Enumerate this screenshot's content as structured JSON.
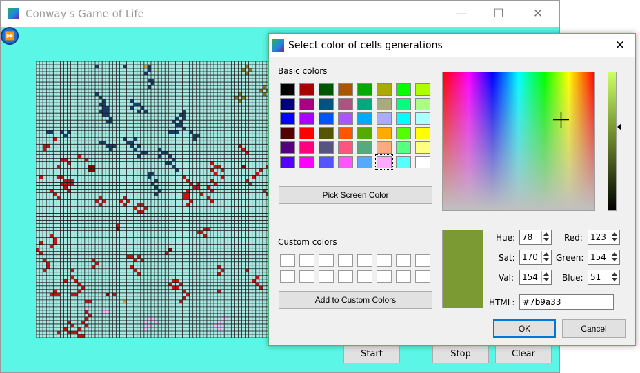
{
  "main_window": {
    "title": "Conway's Game of Life",
    "minimize_glyph": "—",
    "maximize_glyph": "☐",
    "close_glyph": "✕",
    "background_color": "#5bf6e6",
    "buttons": {
      "start": "Start",
      "stop": "Stop",
      "clear": "Clear"
    },
    "fast_forward_glyph": "⏩"
  },
  "grid": {
    "cols": 67,
    "rows": 80,
    "cell_color": "#a8e8e2",
    "line_color": "#1a1a1a",
    "cells": [
      [
        3,
        20,
        "#1b3e6b"
      ],
      [
        4,
        20,
        "#1b3e6b"
      ],
      [
        17,
        1,
        "#1b3e6b"
      ],
      [
        25,
        1,
        "#1b3e6b"
      ],
      [
        31,
        1,
        "#c9b016"
      ],
      [
        32,
        1,
        "#1b3e6b"
      ],
      [
        32,
        2,
        "#1b3e6b"
      ],
      [
        31,
        3,
        "#1b3e6b"
      ],
      [
        32,
        5,
        "#1b3e6b"
      ],
      [
        33,
        5,
        "#1b3e6b"
      ],
      [
        33,
        6,
        "#1b3e6b"
      ],
      [
        32,
        7,
        "#1b3e6b"
      ],
      [
        60,
        1,
        "#8a7a1a"
      ],
      [
        59,
        2,
        "#8a7a1a"
      ],
      [
        61,
        2,
        "#8a7a1a"
      ],
      [
        60,
        3,
        "#8a7a1a"
      ],
      [
        65,
        7,
        "#8a7a1a"
      ],
      [
        64,
        8,
        "#8a7a1a"
      ],
      [
        66,
        8,
        "#8a7a1a"
      ],
      [
        65,
        9,
        "#8a7a1a"
      ],
      [
        58,
        9,
        "#8a7a1a"
      ],
      [
        57,
        10,
        "#8a7a1a"
      ],
      [
        59,
        10,
        "#8a7a1a"
      ],
      [
        58,
        11,
        "#8a7a1a"
      ],
      [
        17,
        9,
        "#1b3e6b"
      ],
      [
        18,
        10,
        "#1b3e6b"
      ],
      [
        19,
        11,
        "#1b3e6b"
      ],
      [
        18,
        12,
        "#1b3e6b"
      ],
      [
        19,
        12,
        "#1b3e6b"
      ],
      [
        19,
        13,
        "#1b3e6b"
      ],
      [
        20,
        13,
        "#1b3e6b"
      ],
      [
        18,
        14,
        "#1b3e6b"
      ],
      [
        19,
        14,
        "#1b3e6b"
      ],
      [
        20,
        14,
        "#1b3e6b"
      ],
      [
        19,
        15,
        "#1b3e6b"
      ],
      [
        20,
        15,
        "#1b3e6b"
      ],
      [
        21,
        16,
        "#1b3e6b"
      ],
      [
        20,
        17,
        "#1b3e6b"
      ],
      [
        21,
        17,
        "#1b3e6b"
      ],
      [
        27,
        11,
        "#1b3e6b"
      ],
      [
        28,
        12,
        "#1b3e6b"
      ],
      [
        29,
        12,
        "#1b3e6b"
      ],
      [
        27,
        13,
        "#1b3e6b"
      ],
      [
        30,
        13,
        "#1b3e6b"
      ],
      [
        31,
        14,
        "#1b3e6b"
      ],
      [
        29,
        14,
        "#1b3e6b"
      ],
      [
        42,
        14,
        "#1b3e6b"
      ],
      [
        41,
        15,
        "#1b3e6b"
      ],
      [
        42,
        15,
        "#1b3e6b"
      ],
      [
        40,
        16,
        "#1b3e6b"
      ],
      [
        42,
        16,
        "#1b3e6b"
      ],
      [
        39,
        17,
        "#1b3e6b"
      ],
      [
        41,
        17,
        "#1b3e6b"
      ],
      [
        40,
        18,
        "#1b3e6b"
      ],
      [
        41,
        18,
        "#1b3e6b"
      ],
      [
        42,
        19,
        "#1b3e6b"
      ],
      [
        38,
        20,
        "#1b3e6b"
      ],
      [
        39,
        20,
        "#1b3e6b"
      ],
      [
        40,
        20,
        "#1b3e6b"
      ],
      [
        7,
        20,
        "#1b3e6b"
      ],
      [
        8,
        21,
        "#1b3e6b"
      ],
      [
        9,
        20,
        "#1b3e6b"
      ],
      [
        18,
        23,
        "#1b3e6b"
      ],
      [
        19,
        23,
        "#1b3e6b"
      ],
      [
        20,
        24,
        "#1b3e6b"
      ],
      [
        21,
        24,
        "#1b3e6b"
      ],
      [
        22,
        24,
        "#1b3e6b"
      ],
      [
        21,
        25,
        "#1b3e6b"
      ],
      [
        25,
        22,
        "#1b3e6b"
      ],
      [
        26,
        23,
        "#1b3e6b"
      ],
      [
        27,
        23,
        "#1b3e6b"
      ],
      [
        28,
        22,
        "#1b3e6b"
      ],
      [
        29,
        24,
        "#1b3e6b"
      ],
      [
        27,
        24,
        "#1b3e6b"
      ],
      [
        28,
        25,
        "#1b3e6b"
      ],
      [
        30,
        26,
        "#1b3e6b"
      ],
      [
        31,
        26,
        "#1b3e6b"
      ],
      [
        29,
        27,
        "#1b3e6b"
      ],
      [
        35,
        25,
        "#1b3e6b"
      ],
      [
        36,
        26,
        "#1b3e6b"
      ],
      [
        37,
        26,
        "#1b3e6b"
      ],
      [
        35,
        27,
        "#1b3e6b"
      ],
      [
        38,
        27,
        "#1b3e6b"
      ],
      [
        39,
        28,
        "#1b3e6b"
      ],
      [
        37,
        29,
        "#1b3e6b"
      ],
      [
        38,
        29,
        "#1b3e6b"
      ],
      [
        39,
        30,
        "#1b3e6b"
      ],
      [
        40,
        31,
        "#1b3e6b"
      ],
      [
        32,
        32,
        "#1b3e6b"
      ],
      [
        33,
        32,
        "#1b3e6b"
      ],
      [
        32,
        33,
        "#1b3e6b"
      ],
      [
        34,
        34,
        "#1b3e6b"
      ],
      [
        33,
        35,
        "#1b3e6b"
      ],
      [
        34,
        36,
        "#1b3e6b"
      ],
      [
        35,
        37,
        "#1b3e6b"
      ],
      [
        34,
        38,
        "#1b3e6b"
      ],
      [
        44,
        20,
        "#1b3e6b"
      ],
      [
        45,
        21,
        "#1b3e6b"
      ],
      [
        46,
        21,
        "#1b3e6b"
      ],
      [
        45,
        22,
        "#1b3e6b"
      ],
      [
        5,
        22,
        "#c41414"
      ],
      [
        2,
        24,
        "#c41414"
      ],
      [
        2,
        25,
        "#c41414"
      ],
      [
        3,
        24,
        "#c41414"
      ],
      [
        7,
        28,
        "#c41414"
      ],
      [
        8,
        28,
        "#c41414"
      ],
      [
        9,
        29,
        "#c41414"
      ],
      [
        6,
        30,
        "#c41414"
      ],
      [
        1,
        33,
        "#c41414"
      ],
      [
        6,
        33,
        "#c41414"
      ],
      [
        7,
        33,
        "#c41414"
      ],
      [
        8,
        34,
        "#c41414"
      ],
      [
        9,
        34,
        "#c41414"
      ],
      [
        10,
        34,
        "#c41414"
      ],
      [
        7,
        35,
        "#c41414"
      ],
      [
        8,
        35,
        "#c41414"
      ],
      [
        9,
        35,
        "#c41414"
      ],
      [
        10,
        35,
        "#c41414"
      ],
      [
        8,
        36,
        "#c41414"
      ],
      [
        9,
        37,
        "#c41414"
      ],
      [
        4,
        37,
        "#c41414"
      ],
      [
        5,
        38,
        "#c41414"
      ],
      [
        6,
        39,
        "#c41414"
      ],
      [
        15,
        30,
        "#8b0000"
      ],
      [
        16,
        30,
        "#8b0000"
      ],
      [
        15,
        31,
        "#8b0000"
      ],
      [
        16,
        31,
        "#8b0000"
      ],
      [
        12,
        27,
        "#c41414"
      ],
      [
        14,
        28,
        "#c41414"
      ],
      [
        18,
        39,
        "#c41414"
      ],
      [
        17,
        40,
        "#c41414"
      ],
      [
        19,
        40,
        "#c41414"
      ],
      [
        18,
        41,
        "#c41414"
      ],
      [
        25,
        39,
        "#c41414"
      ],
      [
        24,
        40,
        "#c41414"
      ],
      [
        26,
        40,
        "#c41414"
      ],
      [
        25,
        41,
        "#c41414"
      ],
      [
        29,
        41,
        "#c41414"
      ],
      [
        30,
        41,
        "#c41414"
      ],
      [
        28,
        42,
        "#c41414"
      ],
      [
        31,
        42,
        "#c41414"
      ],
      [
        29,
        43,
        "#c41414"
      ],
      [
        30,
        43,
        "#c41414"
      ],
      [
        42,
        33,
        "#c41414"
      ],
      [
        43,
        34,
        "#c41414"
      ],
      [
        44,
        35,
        "#c41414"
      ],
      [
        46,
        35,
        "#c41414"
      ],
      [
        45,
        36,
        "#c41414"
      ],
      [
        46,
        36,
        "#c41414"
      ],
      [
        43,
        37,
        "#c41414"
      ],
      [
        42,
        38,
        "#c41414"
      ],
      [
        43,
        38,
        "#c41414"
      ],
      [
        42,
        39,
        "#c41414"
      ],
      [
        43,
        39,
        "#c41414"
      ],
      [
        44,
        40,
        "#c41414"
      ],
      [
        43,
        41,
        "#c41414"
      ],
      [
        50,
        29,
        "#c41414"
      ],
      [
        51,
        30,
        "#c41414"
      ],
      [
        52,
        30,
        "#c41414"
      ],
      [
        50,
        31,
        "#c41414"
      ],
      [
        53,
        31,
        "#c41414"
      ],
      [
        51,
        32,
        "#c41414"
      ],
      [
        53,
        33,
        "#c41414"
      ],
      [
        50,
        34,
        "#c41414"
      ],
      [
        51,
        35,
        "#c41414"
      ],
      [
        49,
        36,
        "#c41414"
      ],
      [
        50,
        37,
        "#c41414"
      ],
      [
        47,
        38,
        "#c41414"
      ],
      [
        49,
        39,
        "#c41414"
      ],
      [
        50,
        40,
        "#c41414"
      ],
      [
        58,
        24,
        "#c41414"
      ],
      [
        59,
        25,
        "#c41414"
      ],
      [
        60,
        26,
        "#c41414"
      ],
      [
        59,
        30,
        "#8b0000"
      ],
      [
        64,
        31,
        "#c41414"
      ],
      [
        63,
        32,
        "#c41414"
      ],
      [
        62,
        33,
        "#c41414"
      ],
      [
        60,
        34,
        "#c41414"
      ],
      [
        61,
        35,
        "#c41414"
      ],
      [
        66,
        30,
        "#c41414"
      ],
      [
        65,
        37,
        "#c41414"
      ],
      [
        66,
        38,
        "#c41414"
      ],
      [
        23,
        47,
        "#c41414"
      ],
      [
        48,
        48,
        "#c41414"
      ],
      [
        49,
        48,
        "#c41414"
      ],
      [
        47,
        49,
        "#c41414"
      ],
      [
        48,
        50,
        "#c41414"
      ],
      [
        23,
        48,
        "#8b0000"
      ],
      [
        46,
        49,
        "#c41414"
      ],
      [
        4,
        50,
        "#c41414"
      ],
      [
        5,
        51,
        "#c41414"
      ],
      [
        5,
        52,
        "#c41414"
      ],
      [
        4,
        53,
        "#c41414"
      ],
      [
        1,
        52,
        "#c41414"
      ],
      [
        0,
        54,
        "#c41414"
      ],
      [
        1,
        55,
        "#c41414"
      ],
      [
        38,
        54,
        "#8b0000"
      ],
      [
        37,
        55,
        "#c41414"
      ],
      [
        2,
        57,
        "#c41414"
      ],
      [
        3,
        58,
        "#c41414"
      ],
      [
        3,
        59,
        "#c41414"
      ],
      [
        2,
        60,
        "#c41414"
      ],
      [
        16,
        57,
        "#c41414"
      ],
      [
        17,
        58,
        "#c41414"
      ],
      [
        16,
        59,
        "#c41414"
      ],
      [
        26,
        56,
        "#c41414"
      ],
      [
        27,
        56,
        "#c41414"
      ],
      [
        28,
        57,
        "#c41414"
      ],
      [
        29,
        56,
        "#c41414"
      ],
      [
        30,
        57,
        "#c41414"
      ],
      [
        27,
        59,
        "#c41414"
      ],
      [
        28,
        60,
        "#c41414"
      ],
      [
        29,
        61,
        "#c41414"
      ],
      [
        10,
        60,
        "#c41414"
      ],
      [
        10,
        62,
        "#c41414"
      ],
      [
        8,
        63,
        "#c41414"
      ],
      [
        11,
        63,
        "#c41414"
      ],
      [
        12,
        64,
        "#c41414"
      ],
      [
        13,
        65,
        "#c41414"
      ],
      [
        12,
        66,
        "#c41414"
      ],
      [
        39,
        63,
        "#c41414"
      ],
      [
        40,
        63,
        "#c41414"
      ],
      [
        38,
        64,
        "#c41414"
      ],
      [
        41,
        64,
        "#c41414"
      ],
      [
        39,
        65,
        "#c41414"
      ],
      [
        40,
        65,
        "#c41414"
      ],
      [
        52,
        59,
        "#c41414"
      ],
      [
        53,
        60,
        "#c41414"
      ],
      [
        52,
        61,
        "#c41414"
      ],
      [
        60,
        60,
        "#c41414"
      ],
      [
        63,
        62,
        "#c41414"
      ],
      [
        62,
        63,
        "#c41414"
      ],
      [
        63,
        64,
        "#c41414"
      ],
      [
        64,
        65,
        "#c41414"
      ],
      [
        52,
        66,
        "#c41414"
      ],
      [
        5,
        66,
        "#c41414"
      ],
      [
        6,
        67,
        "#c41414"
      ],
      [
        10,
        67,
        "#c41414"
      ],
      [
        11,
        67,
        "#c41414"
      ],
      [
        20,
        67,
        "#8b0000"
      ],
      [
        22,
        67,
        "#c41414"
      ],
      [
        14,
        69,
        "#c41414"
      ],
      [
        15,
        69,
        "#c41414"
      ],
      [
        42,
        66,
        "#c41414"
      ],
      [
        43,
        67,
        "#c41414"
      ],
      [
        42,
        68,
        "#c41414"
      ],
      [
        41,
        69,
        "#c41414"
      ],
      [
        4,
        67,
        "#c41414"
      ],
      [
        5,
        67,
        "#c41414"
      ],
      [
        25,
        69,
        "#e8a010"
      ],
      [
        14,
        71,
        "#ffb6ff"
      ],
      [
        19,
        72,
        "#ffb6ff"
      ],
      [
        20,
        72,
        "#ffb6ff"
      ],
      [
        14,
        72,
        "#c41414"
      ],
      [
        15,
        73,
        "#c41414"
      ],
      [
        14,
        74,
        "#c41414"
      ],
      [
        9,
        75,
        "#c41414"
      ],
      [
        10,
        76,
        "#c41414"
      ],
      [
        13,
        75,
        "#c41414"
      ],
      [
        14,
        76,
        "#c41414"
      ],
      [
        12,
        77,
        "#c41414"
      ],
      [
        8,
        77,
        "#c41414"
      ],
      [
        9,
        78,
        "#c41414"
      ],
      [
        10,
        78,
        "#c41414"
      ],
      [
        11,
        78,
        "#c41414"
      ],
      [
        12,
        79,
        "#c41414"
      ],
      [
        13,
        79,
        "#c41414"
      ],
      [
        6,
        78,
        "#c41414"
      ],
      [
        31,
        75,
        "#ffb6ff"
      ],
      [
        32,
        74,
        "#ffb6ff"
      ],
      [
        33,
        74,
        "#ffb6ff"
      ],
      [
        34,
        75,
        "#ffb6ff"
      ],
      [
        32,
        76,
        "#ffb6ff"
      ],
      [
        31,
        77,
        "#ffb6ff"
      ],
      [
        52,
        75,
        "#ffb6ff"
      ],
      [
        53,
        74,
        "#ffb6ff"
      ],
      [
        54,
        74,
        "#ffb6ff"
      ],
      [
        53,
        76,
        "#ffb6ff"
      ],
      [
        51,
        76,
        "#ffb6ff"
      ],
      [
        52,
        77,
        "#ffb6ff"
      ]
    ]
  },
  "dialog": {
    "title": "Select color of cells generations",
    "close_glyph": "✕",
    "basic_colors_label": "Basic colors",
    "custom_colors_label": "Custom colors",
    "pick_screen_color": "Pick Screen Color",
    "add_to_custom": "Add to Custom Colors",
    "ok": "OK",
    "cancel": "Cancel",
    "selected_swatch_index": 45,
    "basic_colors": [
      "#000000",
      "#aa0000",
      "#005500",
      "#aa5500",
      "#00aa00",
      "#aaaa00",
      "#00ff00",
      "#aaff00",
      "#00007f",
      "#aa007f",
      "#00557f",
      "#aa557f",
      "#00aa7f",
      "#aaaa7f",
      "#00ff7f",
      "#aaff7f",
      "#0000ff",
      "#aa00ff",
      "#0055ff",
      "#aa55ff",
      "#00aaff",
      "#aaaaff",
      "#00ffff",
      "#aaffff",
      "#550000",
      "#ff0000",
      "#555500",
      "#ff5500",
      "#55aa00",
      "#ffaa00",
      "#55ff00",
      "#ffff00",
      "#55007f",
      "#ff007f",
      "#55557f",
      "#ff557f",
      "#55aa7f",
      "#ffaa7f",
      "#55ff7f",
      "#ffff7f",
      "#5500ff",
      "#ff00ff",
      "#5555ff",
      "#ff55ff",
      "#55aaff",
      "#ffaaff",
      "#55ffff",
      "#ffffff"
    ],
    "fields": {
      "hue_label": "Hue:",
      "hue": "78",
      "sat_label": "Sat:",
      "sat": "170",
      "val_label": "Val:",
      "val": "154",
      "red_label": "Red:",
      "red": "123",
      "green_label": "Green:",
      "green": "154",
      "blue_label": "Blue:",
      "blue": "51",
      "html_label": "HTML:",
      "html": "#7b9a33"
    },
    "current_color": "#7b9a33"
  }
}
